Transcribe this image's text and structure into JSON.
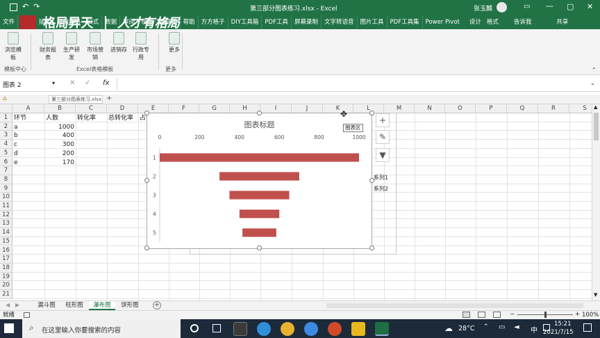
{
  "window": {
    "title": "第三部分图表练习.xlsx - Excel",
    "user": "张玉麟",
    "autosave_icon": "save-icon"
  },
  "watermark": {
    "brand": "格局昇天",
    "slogan": "人才有格局"
  },
  "ribbon_tabs": [
    "文件",
    "开始",
    "插入",
    "页面布局",
    "公式",
    "数据",
    "审阅",
    "视图",
    "加载项",
    "帮助",
    "方方格子",
    "DIY工具箱",
    "PDF工具",
    "屏幕录制",
    "文字转语音",
    "图片工具",
    "PDF工具集",
    "Power Pivot",
    "设计",
    "格式",
    "告诉我",
    "共享"
  ],
  "ribbon": {
    "buttons": [
      "浏览模板",
      "财务报表",
      "生产研发",
      "市场营销",
      "进销存",
      "行政专用",
      "更多"
    ],
    "groups": [
      "模板中心",
      "Excel表格模板",
      "更多"
    ]
  },
  "formula_bar": {
    "name_box": "图表 2",
    "fx": "fx",
    "content": ""
  },
  "workbook_tabs": {
    "file": "第三部分图表练习.xlsx"
  },
  "columns": [
    "A",
    "B",
    "C",
    "D",
    "E",
    "F",
    "G",
    "H",
    "I",
    "J",
    "K",
    "L",
    "M",
    "N",
    "O",
    "P",
    "Q",
    "R",
    "S"
  ],
  "rows": [
    "1",
    "2",
    "3",
    "4",
    "5",
    "6",
    "7",
    "8",
    "9",
    "10",
    "11",
    "12",
    "13",
    "14",
    "15",
    "16",
    "17",
    "18",
    "19",
    "20",
    "21"
  ],
  "table": {
    "headers": [
      "环节",
      "人数",
      "转化率",
      "总转化率",
      "占位"
    ],
    "rows": [
      [
        "a",
        "1000"
      ],
      [
        "b",
        "400"
      ],
      [
        "c",
        "300"
      ],
      [
        "d",
        "200"
      ],
      [
        "e",
        "170"
      ]
    ]
  },
  "chart_data": {
    "type": "bar",
    "title": "图表标题",
    "orientation": "horizontal",
    "categories": [
      "1",
      "2",
      "3",
      "4",
      "5"
    ],
    "series": [
      {
        "name": "系列1",
        "values": [
          0,
          300,
          350,
          400,
          415
        ],
        "color": "none"
      },
      {
        "name": "系列2",
        "values": [
          1000,
          400,
          300,
          200,
          170
        ],
        "color": "#c0504d"
      }
    ],
    "xlim": [
      0,
      1000
    ],
    "xticks": [
      "0",
      "200",
      "400",
      "600",
      "800",
      "1000"
    ],
    "tooltip": "图表区",
    "legend_position": "right"
  },
  "sheet_tabs": [
    "漏斗图",
    "柱形图",
    "瀑布图",
    "饼形图"
  ],
  "active_sheet": 2,
  "status": {
    "left": "就绪",
    "zoom": "100%"
  },
  "taskbar": {
    "search_placeholder": "在这里输入你要搜索的内容",
    "weather": "28°C",
    "ime": "中",
    "time": "15:21",
    "date": "2021/7/15"
  },
  "colors": {
    "excel_green": "#217346",
    "bar_red": "#c0504d",
    "taskbar": "#1c2a3a"
  }
}
